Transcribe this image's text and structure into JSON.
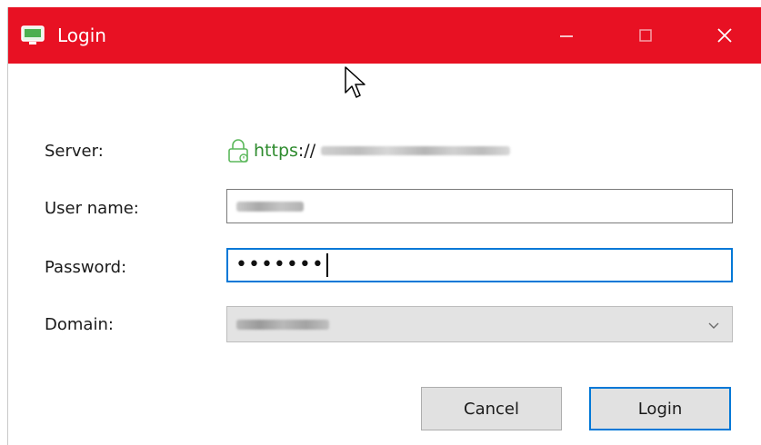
{
  "window": {
    "title": "Login",
    "accent_color": "#e81123",
    "icons": {
      "app": "monitor-icon",
      "minimize": "minimize-icon",
      "maximize": "maximize-icon",
      "close": "close-icon"
    }
  },
  "form": {
    "server_label": "Server:",
    "server_scheme": "https",
    "server_separator": "://",
    "server_host": "",
    "username_label": "User name:",
    "username_value": "",
    "password_label": "Password:",
    "password_mask": "•••••••",
    "domain_label": "Domain:",
    "domain_value": ""
  },
  "buttons": {
    "cancel": "Cancel",
    "login": "Login"
  },
  "colors": {
    "secure_green": "#2e8b2e",
    "focus_blue": "#0078d7"
  }
}
